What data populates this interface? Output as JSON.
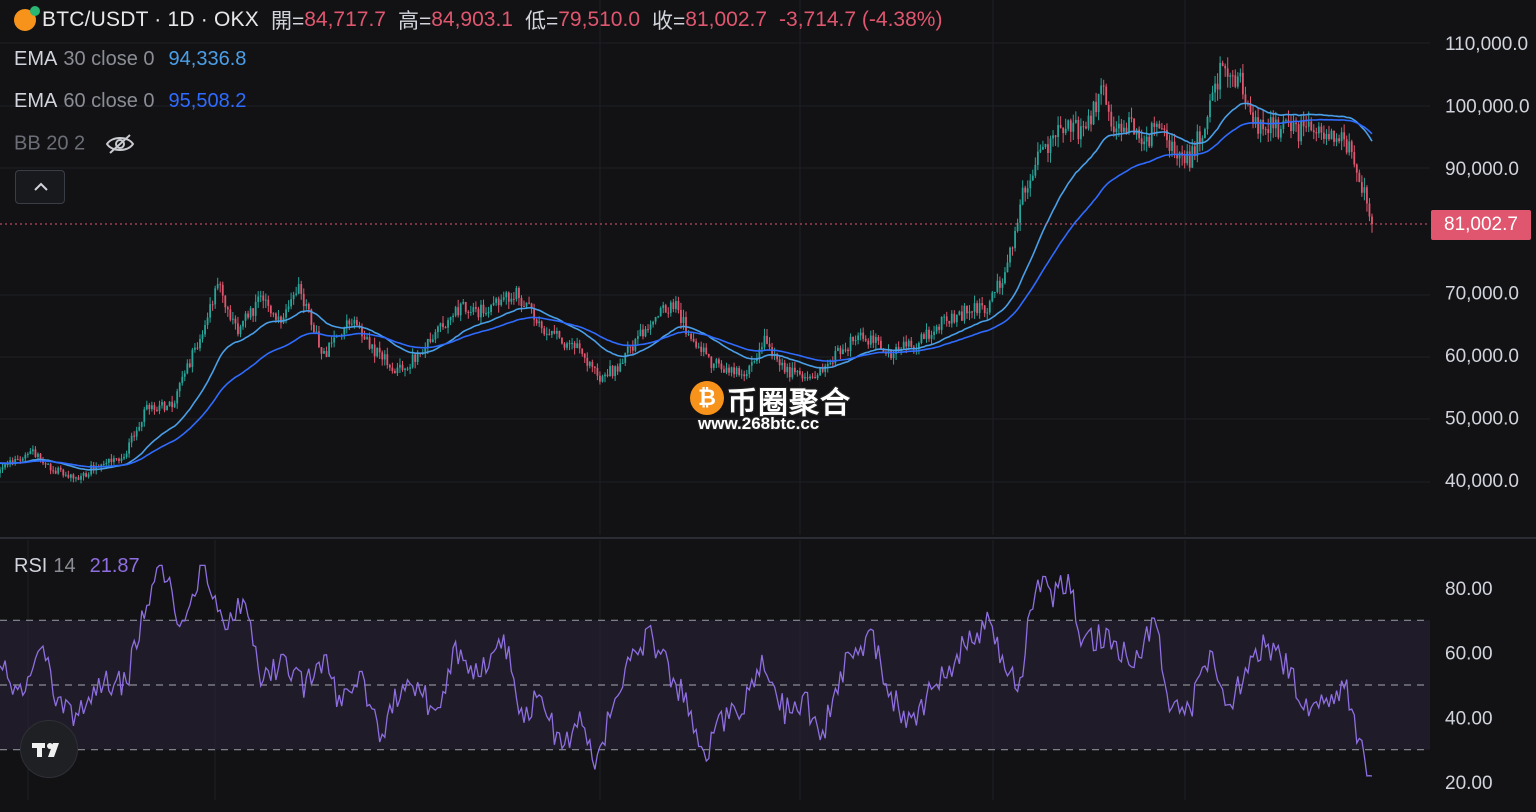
{
  "header": {
    "symbol": "BTC/USDT · 1D · OKX",
    "open_label": "開=",
    "open_value": "84,717.7",
    "high_label": "高=",
    "high_value": "84,903.1",
    "low_label": "低=",
    "low_value": "79,510.0",
    "close_label": "收=",
    "close_value": "81,002.7",
    "change": "-3,714.7 (-4.38%)"
  },
  "indicators": {
    "ema30": {
      "name": "EMA",
      "params": "30 close 0",
      "value": "94,336.8",
      "color": "#4a9fe8"
    },
    "ema60": {
      "name": "EMA",
      "params": "60 close 0",
      "value": "95,508.2",
      "color": "#2f6bff"
    },
    "bb": {
      "label": "BB 20 2",
      "icon": "eye-off-icon"
    },
    "rsi": {
      "name": "RSI",
      "params": "14",
      "value": "21.87",
      "color": "#7e57c2"
    }
  },
  "last_price_tag": "81,002.7",
  "watermark": {
    "brand": "币圈聚合",
    "url": "www.268btc.cc",
    "coin_glyph": "₿"
  },
  "colors": {
    "up": "#26a69a",
    "down": "#e0566f",
    "background": "#121214",
    "rsi_band": "#2a2238"
  },
  "chart_data": [
    {
      "type": "candlestick",
      "title": "BTC/USDT · 1D · OKX",
      "ylim": [
        35000,
        112000
      ],
      "y_ticks": [
        "110,000.0",
        "100,000.0",
        "90,000.0",
        "70,000.0",
        "60,000.0",
        "50,000.0",
        "40,000.0"
      ],
      "y_tick_values": [
        110000,
        100000,
        90000,
        70000,
        60000,
        50000,
        40000
      ],
      "last_close": 81002.7,
      "close_waypoints": [
        [
          0,
          42000
        ],
        [
          12,
          44500
        ],
        [
          22,
          41500
        ],
        [
          30,
          39800
        ],
        [
          38,
          42500
        ],
        [
          48,
          43000
        ],
        [
          58,
          51500
        ],
        [
          68,
          52000
        ],
        [
          78,
          62000
        ],
        [
          86,
          71500
        ],
        [
          94,
          64000
        ],
        [
          104,
          69500
        ],
        [
          110,
          65500
        ],
        [
          118,
          70500
        ],
        [
          128,
          60000
        ],
        [
          138,
          66000
        ],
        [
          148,
          60500
        ],
        [
          158,
          57500
        ],
        [
          168,
          61000
        ],
        [
          180,
          67500
        ],
        [
          192,
          67000
        ],
        [
          204,
          70000
        ],
        [
          214,
          64500
        ],
        [
          228,
          61000
        ],
        [
          236,
          56500
        ],
        [
          244,
          58000
        ],
        [
          256,
          65000
        ],
        [
          266,
          68500
        ],
        [
          274,
          62000
        ],
        [
          282,
          58500
        ],
        [
          294,
          57000
        ],
        [
          302,
          62500
        ],
        [
          310,
          57500
        ],
        [
          320,
          56000
        ],
        [
          332,
          60500
        ],
        [
          340,
          63500
        ],
        [
          352,
          60500
        ],
        [
          360,
          61500
        ],
        [
          372,
          65000
        ],
        [
          382,
          67000
        ],
        [
          390,
          67500
        ],
        [
          398,
          74000
        ],
        [
          404,
          86000
        ],
        [
          412,
          93000
        ],
        [
          420,
          97000
        ],
        [
          428,
          96000
        ],
        [
          436,
          103000
        ],
        [
          440,
          95500
        ],
        [
          446,
          97000
        ],
        [
          452,
          94000
        ],
        [
          458,
          97000
        ],
        [
          464,
          93000
        ],
        [
          470,
          91000
        ],
        [
          476,
          97500
        ],
        [
          482,
          105500
        ],
        [
          490,
          104000
        ],
        [
          496,
          96500
        ],
        [
          506,
          96500
        ],
        [
          512,
          95500
        ],
        [
          518,
          97000
        ],
        [
          526,
          95000
        ],
        [
          532,
          94000
        ],
        [
          536,
          89000
        ],
        [
          540,
          84717.7
        ],
        [
          542,
          81002.7
        ]
      ],
      "ema_series": [
        {
          "name": "EMA 30 close 0",
          "last": 94336.8,
          "color": "#4a9fe8"
        },
        {
          "name": "EMA 60 close 0",
          "last": 95508.2,
          "color": "#2f6bff"
        }
      ]
    },
    {
      "type": "line",
      "title": "RSI 14",
      "ylim": [
        20,
        87
      ],
      "y_ticks": [
        "80.00",
        "60.00",
        "40.00",
        "20.00"
      ],
      "y_tick_values": [
        80,
        60,
        40,
        20
      ],
      "bands": [
        70,
        50,
        30
      ],
      "last": 21.87,
      "waypoints": [
        [
          0,
          56
        ],
        [
          8,
          47
        ],
        [
          16,
          63
        ],
        [
          22,
          46
        ],
        [
          30,
          40
        ],
        [
          40,
          52
        ],
        [
          50,
          50
        ],
        [
          58,
          78
        ],
        [
          64,
          85
        ],
        [
          72,
          69
        ],
        [
          80,
          87
        ],
        [
          88,
          70
        ],
        [
          96,
          77
        ],
        [
          104,
          50
        ],
        [
          112,
          58
        ],
        [
          120,
          50
        ],
        [
          128,
          58
        ],
        [
          134,
          45
        ],
        [
          142,
          52
        ],
        [
          150,
          35
        ],
        [
          158,
          48
        ],
        [
          166,
          50
        ],
        [
          172,
          38
        ],
        [
          180,
          62
        ],
        [
          186,
          55
        ],
        [
          194,
          58
        ],
        [
          200,
          62
        ],
        [
          206,
          42
        ],
        [
          214,
          45
        ],
        [
          222,
          30
        ],
        [
          228,
          40
        ],
        [
          236,
          26
        ],
        [
          244,
          50
        ],
        [
          250,
          57
        ],
        [
          256,
          66
        ],
        [
          262,
          58
        ],
        [
          270,
          46
        ],
        [
          278,
          28
        ],
        [
          286,
          40
        ],
        [
          294,
          44
        ],
        [
          302,
          58
        ],
        [
          310,
          42
        ],
        [
          318,
          46
        ],
        [
          324,
          32
        ],
        [
          330,
          50
        ],
        [
          336,
          60
        ],
        [
          344,
          65
        ],
        [
          352,
          47
        ],
        [
          360,
          38
        ],
        [
          368,
          48
        ],
        [
          374,
          55
        ],
        [
          382,
          63
        ],
        [
          390,
          70
        ],
        [
          396,
          58
        ],
        [
          402,
          48
        ],
        [
          410,
          84
        ],
        [
          416,
          78
        ],
        [
          422,
          82
        ],
        [
          428,
          63
        ],
        [
          436,
          66
        ],
        [
          442,
          62
        ],
        [
          448,
          55
        ],
        [
          456,
          70
        ],
        [
          462,
          46
        ],
        [
          470,
          42
        ],
        [
          478,
          58
        ],
        [
          486,
          42
        ],
        [
          492,
          55
        ],
        [
          500,
          62
        ],
        [
          508,
          56
        ],
        [
          514,
          45
        ],
        [
          520,
          43
        ],
        [
          528,
          46
        ],
        [
          532,
          50
        ],
        [
          536,
          35
        ],
        [
          540,
          24
        ],
        [
          542,
          21.87
        ]
      ]
    }
  ]
}
